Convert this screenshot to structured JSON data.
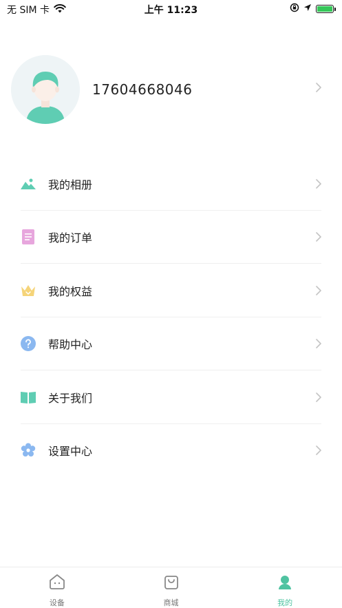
{
  "status_bar": {
    "carrier": "无 SIM 卡",
    "time": "上午 11:23"
  },
  "profile": {
    "phone": "17604668046"
  },
  "menu": [
    {
      "label": "我的相册",
      "icon": "album-icon",
      "color": "#5fcdb3"
    },
    {
      "label": "我的订单",
      "icon": "order-icon",
      "color": "#e7a6dd"
    },
    {
      "label": "我的权益",
      "icon": "crown-icon",
      "color": "#f5d479"
    },
    {
      "label": "帮助中心",
      "icon": "help-icon",
      "color": "#8bb8f0"
    },
    {
      "label": "关于我们",
      "icon": "book-icon",
      "color": "#5fcdb3"
    },
    {
      "label": "设置中心",
      "icon": "settings-icon",
      "color": "#8bb8f0"
    }
  ],
  "tabbar": [
    {
      "label": "设备",
      "icon": "device-icon"
    },
    {
      "label": "商城",
      "icon": "shop-icon"
    },
    {
      "label": "我的",
      "icon": "profile-icon",
      "active": true
    }
  ],
  "colors": {
    "accent": "#4fc3a1",
    "text": "#222222",
    "divider": "#efefef"
  }
}
